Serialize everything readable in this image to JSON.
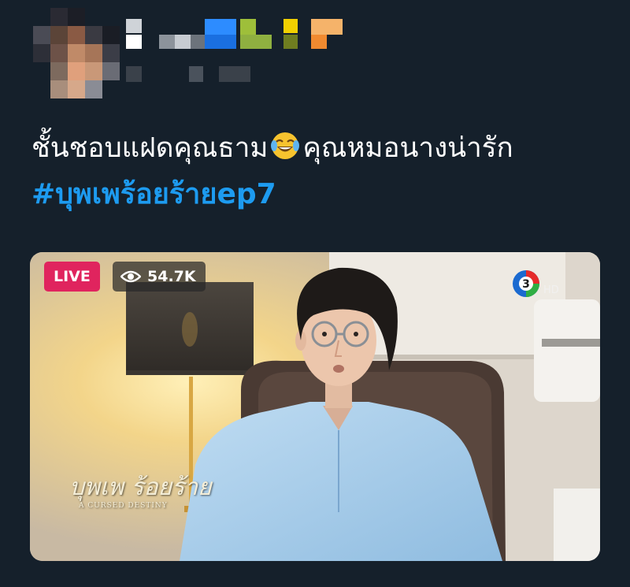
{
  "tweet": {
    "text": "ชั้นชอบแฝดคุณธาม",
    "emoji": "face-with-tears-of-joy",
    "text_after_emoji": "คุณหมอนางน่ารัก",
    "hashtag": "#บุพเพร้อยร้ายep7"
  },
  "media": {
    "live_label": "LIVE",
    "view_count": "54.7K",
    "channel_logo_icon": "channel-3-hd-logo",
    "show_logo_text": "บุพเพ ร้อยร้าย",
    "show_logo_sub": "A CURSED DESTINY"
  },
  "colors": {
    "background": "#15202b",
    "hashtag": "#1d9bf0",
    "live": "#e0245e"
  }
}
